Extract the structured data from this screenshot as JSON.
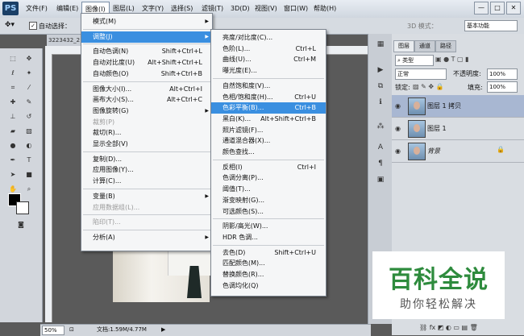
{
  "app": {
    "logo": "PS"
  },
  "menubar": [
    "文件(F)",
    "编辑(E)",
    "图像(I)",
    "图层(L)",
    "文字(Y)",
    "选择(S)",
    "滤镜(T)",
    "3D(D)",
    "视图(V)",
    "窗口(W)",
    "帮助(H)"
  ],
  "window_controls": [
    "—",
    "□",
    "✕"
  ],
  "options": {
    "auto_select": "自动选择：",
    "mode_3d": "3D 模式：",
    "workspace": "基本功能"
  },
  "document": {
    "tab": "3223432_2",
    "zoom": "50%",
    "doc_info": "文档:1.59M/4.77M"
  },
  "image_menu": {
    "items": [
      {
        "label": "模式(M)",
        "shortcut": "",
        "submenu": true,
        "disabled": false,
        "highlight": false
      },
      {
        "sep": true
      },
      {
        "label": "调整(J)",
        "shortcut": "",
        "submenu": true,
        "disabled": false,
        "highlight": true
      },
      {
        "sep": true
      },
      {
        "label": "自动色调(N)",
        "shortcut": "Shift+Ctrl+L"
      },
      {
        "label": "自动对比度(U)",
        "shortcut": "Alt+Shift+Ctrl+L"
      },
      {
        "label": "自动颜色(O)",
        "shortcut": "Shift+Ctrl+B"
      },
      {
        "sep": true
      },
      {
        "label": "图像大小(I)...",
        "shortcut": "Alt+Ctrl+I"
      },
      {
        "label": "画布大小(S)...",
        "shortcut": "Alt+Ctrl+C"
      },
      {
        "label": "图像旋转(G)",
        "shortcut": "",
        "submenu": true
      },
      {
        "label": "裁剪(P)",
        "shortcut": "",
        "disabled": true
      },
      {
        "label": "裁切(R)...",
        "shortcut": ""
      },
      {
        "label": "显示全部(V)",
        "shortcut": ""
      },
      {
        "sep": true
      },
      {
        "label": "复制(D)...",
        "shortcut": ""
      },
      {
        "label": "应用图像(Y)...",
        "shortcut": ""
      },
      {
        "label": "计算(C)...",
        "shortcut": ""
      },
      {
        "sep": true
      },
      {
        "label": "变量(B)",
        "shortcut": "",
        "submenu": true
      },
      {
        "label": "应用数据组(L)...",
        "shortcut": "",
        "disabled": true
      },
      {
        "sep": true
      },
      {
        "label": "陷印(T)...",
        "shortcut": "",
        "disabled": true
      },
      {
        "sep": true
      },
      {
        "label": "分析(A)",
        "shortcut": "",
        "submenu": true
      }
    ]
  },
  "adjust_menu": {
    "items": [
      {
        "label": "亮度/对比度(C)...",
        "shortcut": ""
      },
      {
        "label": "色阶(L)...",
        "shortcut": "Ctrl+L"
      },
      {
        "label": "曲线(U)...",
        "shortcut": "Ctrl+M"
      },
      {
        "label": "曝光度(E)...",
        "shortcut": ""
      },
      {
        "sep": true
      },
      {
        "label": "自然饱和度(V)...",
        "shortcut": ""
      },
      {
        "label": "色相/饱和度(H)...",
        "shortcut": "Ctrl+U"
      },
      {
        "label": "色彩平衡(B)...",
        "shortcut": "Ctrl+B",
        "highlight": true
      },
      {
        "label": "黑白(K)...",
        "shortcut": "Alt+Shift+Ctrl+B"
      },
      {
        "label": "照片滤镜(F)...",
        "shortcut": ""
      },
      {
        "label": "通道混合器(X)...",
        "shortcut": ""
      },
      {
        "label": "颜色查找...",
        "shortcut": ""
      },
      {
        "sep": true
      },
      {
        "label": "反相(I)",
        "shortcut": "Ctrl+I"
      },
      {
        "label": "色调分离(P)...",
        "shortcut": ""
      },
      {
        "label": "阈值(T)...",
        "shortcut": ""
      },
      {
        "label": "渐变映射(G)...",
        "shortcut": ""
      },
      {
        "label": "可选颜色(S)...",
        "shortcut": ""
      },
      {
        "sep": true
      },
      {
        "label": "阴影/高光(W)...",
        "shortcut": ""
      },
      {
        "label": "HDR 色调...",
        "shortcut": ""
      },
      {
        "sep": true
      },
      {
        "label": "去色(D)",
        "shortcut": "Shift+Ctrl+U"
      },
      {
        "label": "匹配颜色(M)...",
        "shortcut": ""
      },
      {
        "label": "替换颜色(R)...",
        "shortcut": ""
      },
      {
        "label": "色调均化(Q)",
        "shortcut": ""
      }
    ]
  },
  "layers_panel": {
    "tabs": [
      "图层",
      "通道",
      "路径"
    ],
    "filter": "类型",
    "blend": "正常",
    "opacity_label": "不透明度:",
    "opacity": "100%",
    "lock_label": "锁定:",
    "fill_label": "填充:",
    "fill": "100%",
    "layers": [
      {
        "name": "图层 1 拷贝",
        "selected": true
      },
      {
        "name": "图层 1",
        "selected": false
      },
      {
        "name": "背景",
        "selected": false
      }
    ]
  },
  "watermark": {
    "title": "百科全说",
    "subtitle": "助你轻松解决"
  }
}
